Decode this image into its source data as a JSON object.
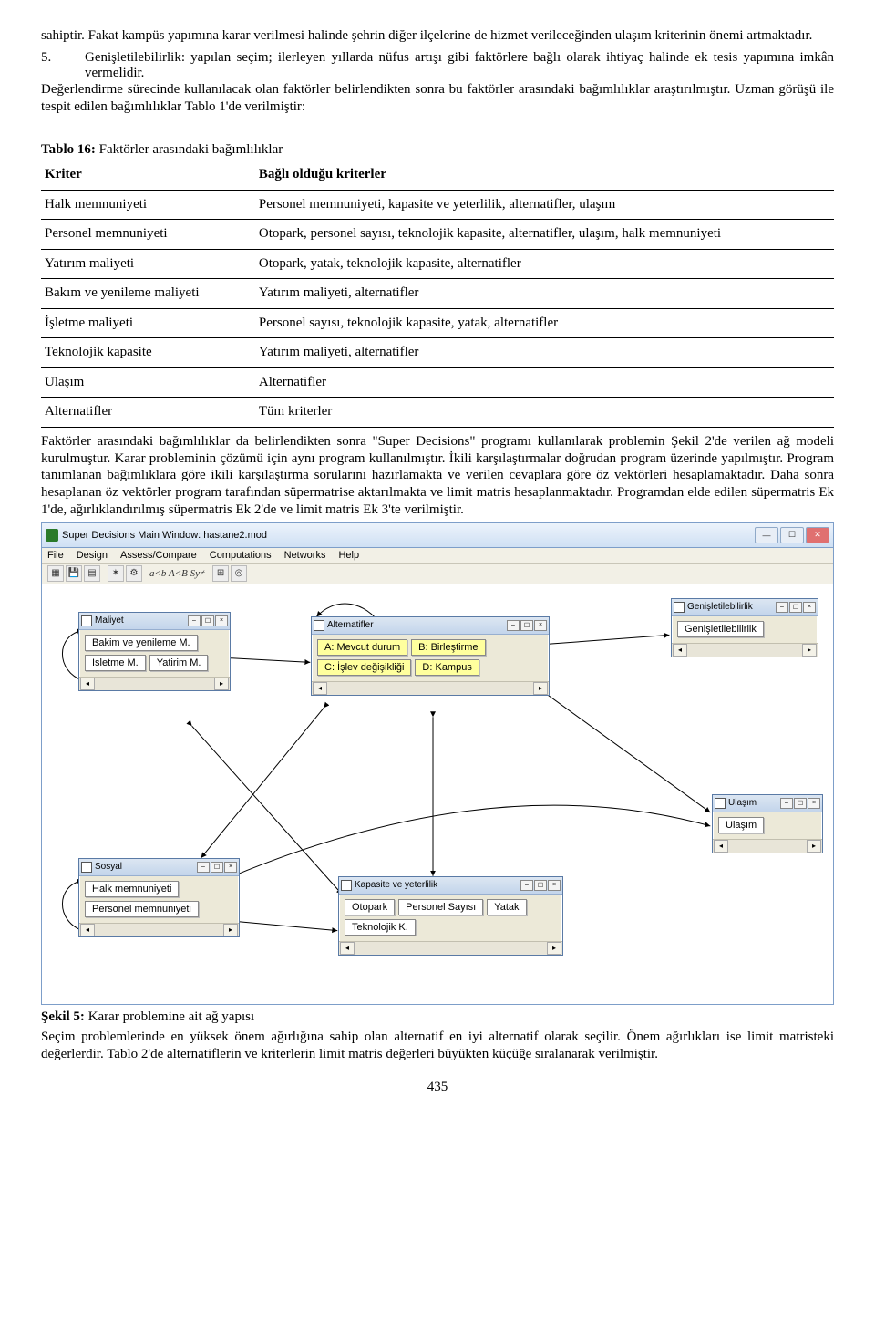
{
  "intro": {
    "p_prev": "sahiptir. Fakat kampüs yapımına karar verilmesi halinde şehrin diğer ilçelerine de hizmet verileceğinden ulaşım kriterinin önemi artmaktadır.",
    "list_num": "5.",
    "list_txt": "Genişletilebilirlik: yapılan seçim; ilerleyen yıllarda nüfus artışı gibi faktörlere bağlı olarak ihtiyaç halinde ek tesis yapımına imkân vermelidir.",
    "p_after": "Değerlendirme sürecinde kullanılacak olan faktörler belirlendikten sonra bu faktörler arasındaki bağımlılıklar araştırılmıştır. Uzman görüşü ile tespit edilen bağımlılıklar Tablo 1'de verilmiştir:"
  },
  "table": {
    "caption_bold": "Tablo 16:",
    "caption_rest": " Faktörler arasındaki bağımlılıklar",
    "header_left": "Kriter",
    "header_right": "Bağlı olduğu kriterler",
    "rows": [
      {
        "k": "Halk memnuniyeti",
        "v": "Personel memnuniyeti, kapasite ve yeterlilik, alternatifler, ulaşım"
      },
      {
        "k": "Personel memnuniyeti",
        "v": "Otopark, personel sayısı, teknolojik kapasite, alternatifler, ulaşım, halk memnuniyeti"
      },
      {
        "k": "Yatırım maliyeti",
        "v": "Otopark, yatak, teknolojik kapasite, alternatifler"
      },
      {
        "k": "Bakım ve yenileme maliyeti",
        "v": "Yatırım maliyeti, alternatifler"
      },
      {
        "k": "İşletme maliyeti",
        "v": "Personel sayısı, teknolojik kapasite, yatak, alternatifler"
      },
      {
        "k": "Teknolojik kapasite",
        "v": "Yatırım maliyeti, alternatifler"
      },
      {
        "k": "Ulaşım",
        "v": "Alternatifler"
      },
      {
        "k": "Alternatifler",
        "v": "Tüm kriterler"
      }
    ]
  },
  "after_table": "Faktörler arasındaki bağımlılıklar da belirlendikten sonra \"Super Decisions\" programı kullanılarak problemin Şekil 2'de verilen ağ modeli kurulmuştur. Karar probleminin çözümü için aynı program kullanılmıştır. İkili karşılaştırmalar doğrudan program üzerinde yapılmıştır. Program tanımlanan bağımlıklara göre ikili karşılaştırma sorularını hazırlamakta ve verilen cevaplara göre öz vektörleri hesaplamaktadır. Daha sonra hesaplanan öz vektörler program tarafından süpermatrise aktarılmakta ve limit matris hesaplanmaktadır. Programdan elde edilen süpermatris Ek 1'de, ağırlıklandırılmış süpermatris Ek 2'de ve limit matris Ek 3'te verilmiştir.",
  "sd": {
    "title": "Super Decisions Main Window: hastane2.mod",
    "menu": [
      "File",
      "Design",
      "Assess/Compare",
      "Computations",
      "Networks",
      "Help"
    ],
    "formula": "a<b A<B Sy≠",
    "clusters": {
      "maliyet": {
        "title": "Maliyet",
        "nodes": [
          "Bakim ve yenileme M.",
          "Isletme M.",
          "Yatirim M."
        ]
      },
      "alternatifler": {
        "title": "Alternatifler",
        "nodes": [
          "A: Mevcut durum",
          "B: Birleştirme",
          "C: İşlev değişikliği",
          "D: Kampus"
        ]
      },
      "genisletilebilirlik": {
        "title": "Genişletilebilirlik",
        "nodes": [
          "Genişletilebilirlik"
        ]
      },
      "ulasim": {
        "title": "Ulaşım",
        "nodes": [
          "Ulaşım"
        ]
      },
      "sosyal": {
        "title": "Sosyal",
        "nodes": [
          "Halk memnuniyeti",
          "Personel memnuniyeti"
        ]
      },
      "kapasite": {
        "title": "Kapasite ve yeterlilik",
        "nodes": [
          "Otopark",
          "Personel Sayısı",
          "Yatak",
          "Teknolojik K."
        ]
      }
    }
  },
  "figure": {
    "bold": "Şekil 5:",
    "rest": " Karar problemine ait ağ yapısı",
    "para": "Seçim problemlerinde en yüksek önem ağırlığına sahip olan alternatif en iyi alternatif olarak seçilir. Önem ağırlıkları ise limit matristeki değerlerdir. Tablo 2'de alternatiflerin ve kriterlerin limit matris değerleri büyükten küçüğe sıralanarak verilmiştir."
  },
  "page_number": "435"
}
